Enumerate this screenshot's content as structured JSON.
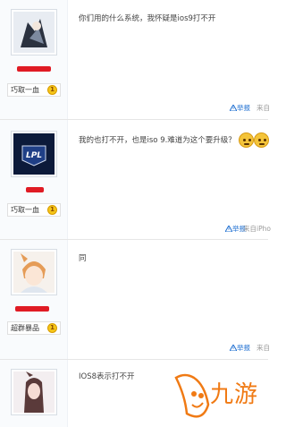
{
  "posts": [
    {
      "level_name": "巧取一血",
      "content": "你们用的什么系统，我怀疑是ios9打不开",
      "report": "举报",
      "source": "来自"
    },
    {
      "level_name": "巧取一血",
      "content": "我的也打不开，也是iso 9.难道为这个要升级？",
      "avatar_text": "LPL",
      "report": "举报",
      "source": "来自iPho"
    },
    {
      "level_name": "超群暴品",
      "content": "同",
      "report": "举报",
      "source": "来自"
    },
    {
      "content": "IOS8表示打不开"
    }
  ],
  "watermark": {
    "text": "九游"
  },
  "colors": {
    "accent_red": "#e01b24",
    "link_blue": "#1e6fd1",
    "watermark_orange": "#f07a14"
  }
}
